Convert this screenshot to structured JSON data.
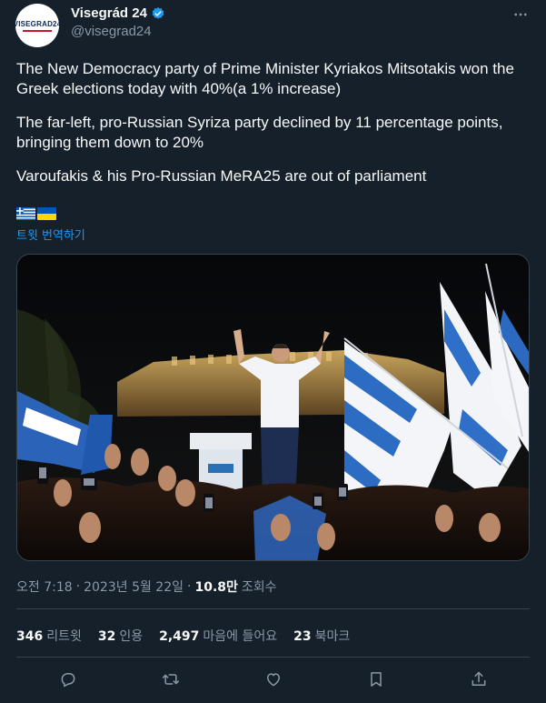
{
  "author": {
    "display_name": "Visegrád 24",
    "handle": "@visegrad24",
    "avatar_text": "VISEGRAD24"
  },
  "tweet": {
    "paragraphs": [
      "The New Democracy party of Prime Minister Kyriakos Mitsotakis won the Greek elections today with 40%(a 1% increase)",
      "The far-left, pro-Russian Syriza party declined by 11 percentage points, bringing them down to 20%",
      "Varoufakis & his Pro-Russian MeRA25 are out of parliament"
    ],
    "flags": [
      "greece-flag",
      "ukraine-flag"
    ],
    "translate_label": "트윗 번역하기"
  },
  "meta": {
    "time": "오전 7:18",
    "separator": "·",
    "date": "2023년 5월 22일",
    "views_count": "10.8만",
    "views_label": "조회수"
  },
  "stats": [
    {
      "count": "346",
      "label": "리트윗"
    },
    {
      "count": "32",
      "label": "인용"
    },
    {
      "count": "2,497",
      "label": "마음에 들어요"
    },
    {
      "count": "23",
      "label": "북마크"
    }
  ],
  "actions": [
    "reply-icon",
    "retweet-icon",
    "like-icon",
    "bookmark-icon",
    "share-icon"
  ],
  "colors": {
    "background": "#15202b",
    "accent": "#1d9bf0",
    "secondary_text": "#8b98a5",
    "border": "#38444d"
  }
}
